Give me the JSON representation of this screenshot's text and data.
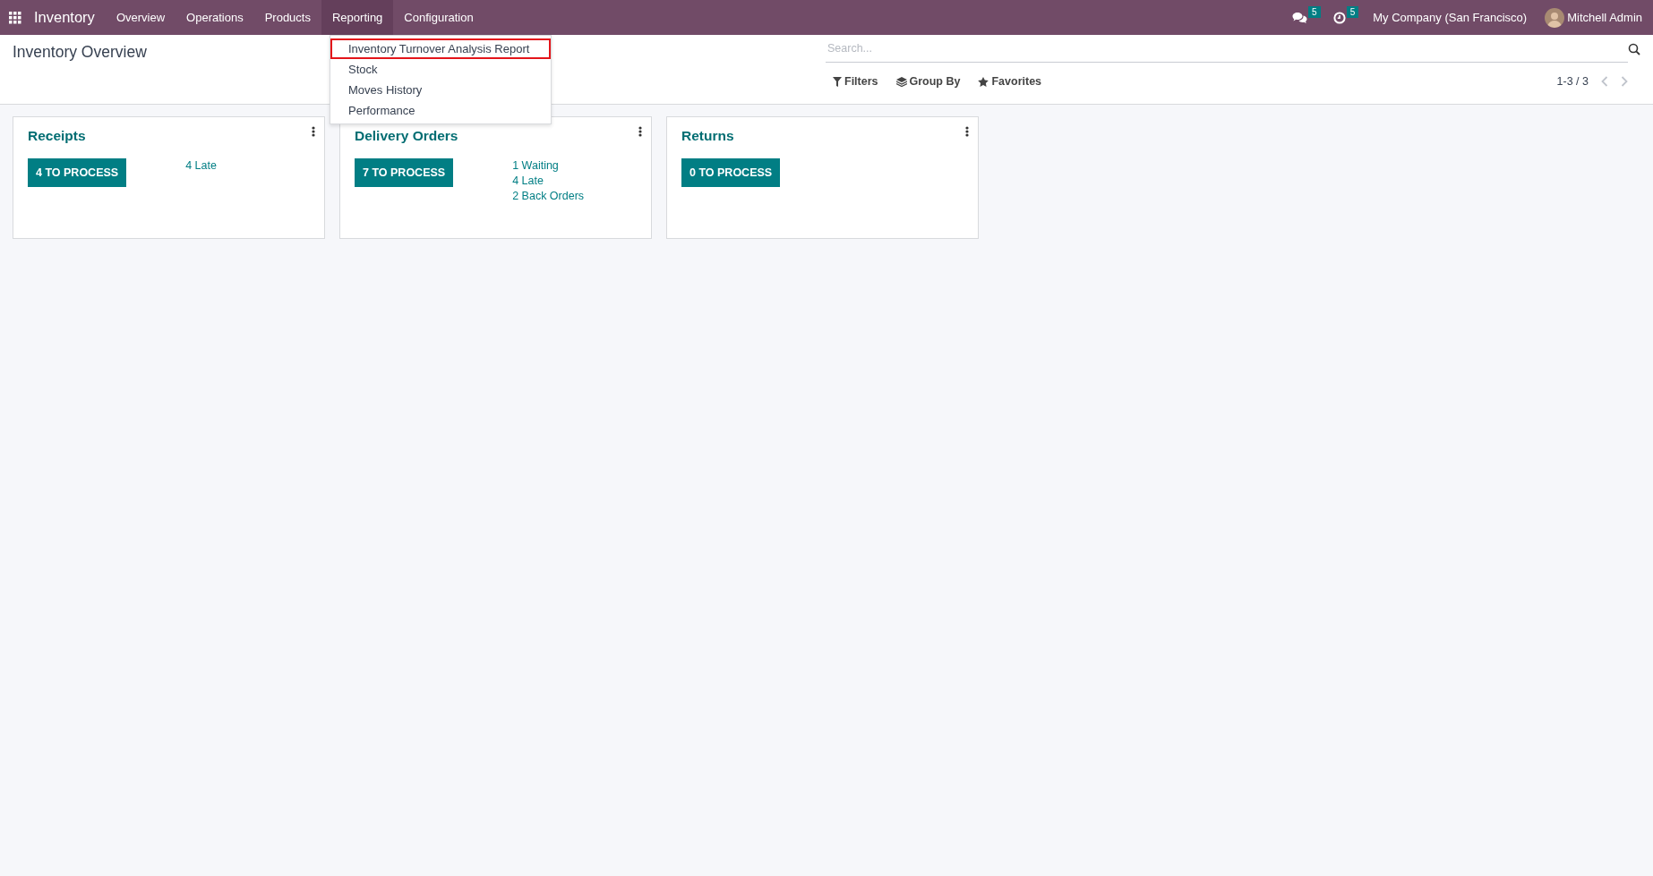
{
  "navbar": {
    "app_name": "Inventory",
    "menu": [
      {
        "label": "Overview",
        "selected": false
      },
      {
        "label": "Operations",
        "selected": false
      },
      {
        "label": "Products",
        "selected": false
      },
      {
        "label": "Reporting",
        "selected": true
      },
      {
        "label": "Configuration",
        "selected": false
      }
    ],
    "messages_count": "5",
    "activities_count": "5",
    "company": "My Company (San Francisco)",
    "user": "Mitchell Admin"
  },
  "dropdown": {
    "items": [
      {
        "label": "Inventory Turnover Analysis Report",
        "selected": true
      },
      {
        "label": "Stock",
        "selected": false
      },
      {
        "label": "Moves History",
        "selected": false
      },
      {
        "label": "Performance",
        "selected": false
      }
    ]
  },
  "control_panel": {
    "title": "Inventory Overview",
    "search": {
      "placeholder": "Search..."
    },
    "filters": "Filters",
    "group_by": "Group By",
    "favorites": "Favorites",
    "pager": "1-3 / 3"
  },
  "cards": [
    {
      "title": "Receipts",
      "button": "4 TO PROCESS",
      "links": [
        "4 Late"
      ]
    },
    {
      "title": "Delivery Orders",
      "button": "7 TO PROCESS",
      "links": [
        "1 Waiting",
        "4 Late",
        "2 Back Orders"
      ]
    },
    {
      "title": "Returns",
      "button": "0 TO PROCESS"
    }
  ]
}
